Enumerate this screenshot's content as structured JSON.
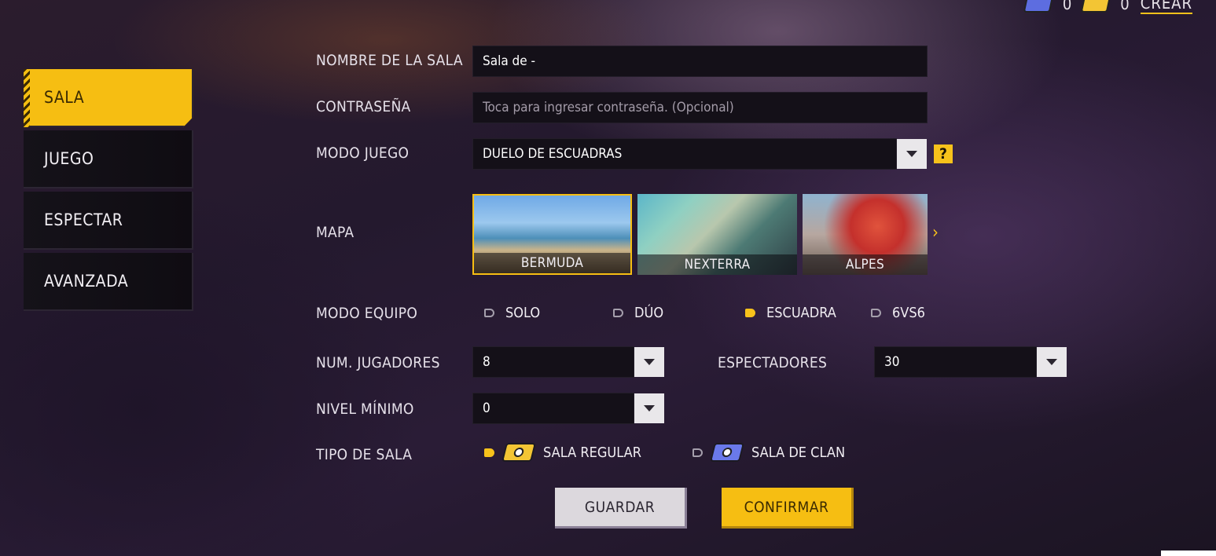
{
  "top": {
    "blue_count": "0",
    "gold_count": "0",
    "create_label": "CREAR"
  },
  "tabs": [
    {
      "label": "SALA",
      "active": true
    },
    {
      "label": "JUEGO",
      "active": false
    },
    {
      "label": "ESPECTAR",
      "active": false
    },
    {
      "label": "AVANZADA",
      "active": false
    }
  ],
  "form": {
    "room_name": {
      "label": "NOMBRE DE LA SALA",
      "value": "Sala de -"
    },
    "password": {
      "label": "CONTRASEÑA",
      "placeholder": "Toca para ingresar contraseña. (Opcional)"
    },
    "game_mode": {
      "label": "MODO JUEGO",
      "value": "DUELO DE ESCUADRAS",
      "help": "?"
    },
    "map": {
      "label": "MAPA",
      "options": [
        {
          "name": "BERMUDA",
          "selected": true
        },
        {
          "name": "NEXTERRA",
          "selected": false
        },
        {
          "name": "ALPES",
          "selected": false
        }
      ]
    },
    "team_mode": {
      "label": "MODO EQUIPO",
      "options": [
        {
          "label": "SOLO",
          "selected": false
        },
        {
          "label": "DÚO",
          "selected": false
        },
        {
          "label": "ESCUADRA",
          "selected": true
        },
        {
          "label": "6VS6",
          "selected": false
        }
      ]
    },
    "players": {
      "label": "NUM. JUGADORES",
      "value": "8"
    },
    "spectators": {
      "label": "ESPECTADORES",
      "value": "30"
    },
    "min_level": {
      "label": "NIVEL MÍNIMO",
      "value": "0"
    },
    "room_type": {
      "label": "TIPO DE SALA",
      "options": [
        {
          "label": "SALA REGULAR",
          "selected": true
        },
        {
          "label": "SALA DE CLAN",
          "selected": false
        }
      ]
    }
  },
  "buttons": {
    "save": "GUARDAR",
    "confirm": "CONFIRMAR"
  },
  "colors": {
    "accent": "#f6be12",
    "panel": "#141018"
  }
}
